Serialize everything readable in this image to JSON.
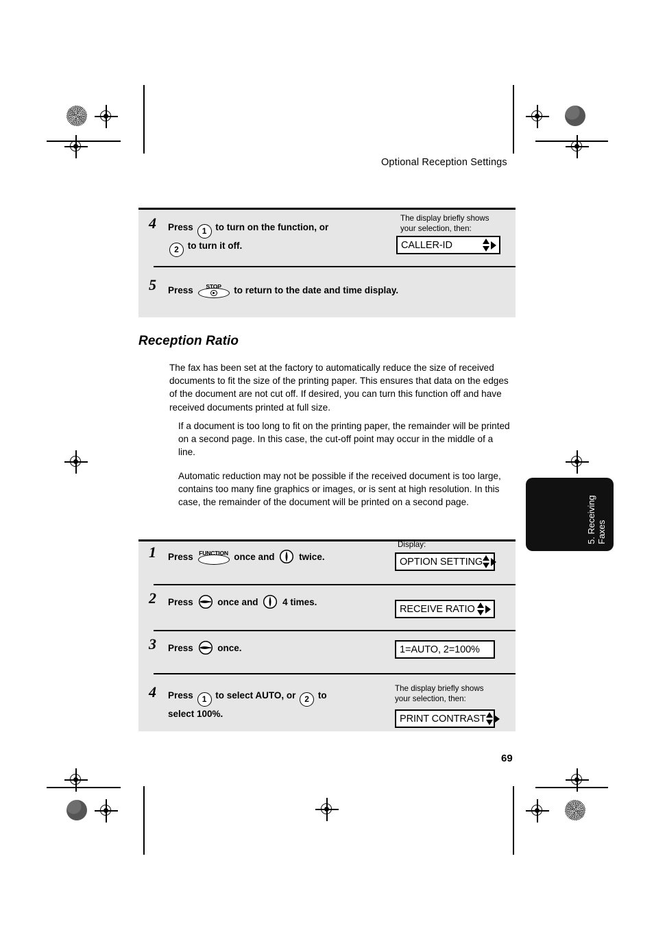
{
  "page": {
    "running_head": "Optional Reception Settings",
    "page_number": "69",
    "thumb_tab": "5. Receiving\nFaxes"
  },
  "top_panel": {
    "steps": [
      {
        "number": "4",
        "lines": [
          {
            "segments": [
              {
                "type": "text",
                "value": "Press "
              },
              {
                "type": "key-circle",
                "value": "1"
              },
              {
                "type": "text",
                "value": " to turn on the function, or"
              }
            ]
          },
          {
            "segments": [
              {
                "type": "key-circle",
                "value": "2"
              },
              {
                "type": "text",
                "value": " to turn it off."
              }
            ]
          }
        ],
        "note": "The display briefly shows\nyour selection, then:",
        "lcd": {
          "text": "CALLER-ID",
          "arrows": "up-down-right"
        }
      },
      {
        "number": "5",
        "lines": [
          {
            "segments": [
              {
                "type": "text",
                "value": "Press "
              },
              {
                "type": "key-stop",
                "value": "STOP"
              },
              {
                "type": "text",
                "value": " to return to the date and time display."
              }
            ]
          }
        ],
        "note": "",
        "lcd": null
      }
    ]
  },
  "section": {
    "heading": "Reception Ratio",
    "paragraphs": [
      "The fax has been set at the factory to automatically reduce the size of received documents to fit the size of the printing paper. This ensures that data on the edges of the document are not cut off. If desired, you can turn this function off and have received documents printed at full size.",
      "If a document is too long to fit on the printing paper, the remainder will be printed on a second page. In this case, the cut-off point may occur in the middle of a line.",
      "Automatic reduction may not be possible if the received document is too large, contains too many fine graphics or images, or is sent at high resolution. In this case, the remainder of the document will be printed on a second page."
    ]
  },
  "bottom_panel": {
    "steps": [
      {
        "number": "1",
        "lines": [
          {
            "segments": [
              {
                "type": "text",
                "value": "Press "
              },
              {
                "type": "key-function",
                "value": "FUNCTION"
              },
              {
                "type": "text",
                "value": " once and "
              },
              {
                "type": "key-down",
                "value": "down"
              },
              {
                "type": "text",
                "value": " twice."
              }
            ]
          }
        ],
        "note": "Display:",
        "lcd": {
          "text": "OPTION SETTING",
          "arrows": "up-down-right"
        }
      },
      {
        "number": "2",
        "lines": [
          {
            "segments": [
              {
                "type": "text",
                "value": "Press "
              },
              {
                "type": "key-right",
                "value": "right"
              },
              {
                "type": "text",
                "value": " once and "
              },
              {
                "type": "key-down",
                "value": "down"
              },
              {
                "type": "text",
                "value": " 4 times."
              }
            ]
          }
        ],
        "note": "",
        "lcd": {
          "text": "RECEIVE RATIO",
          "arrows": "up-down-right"
        }
      },
      {
        "number": "3",
        "lines": [
          {
            "segments": [
              {
                "type": "text",
                "value": "Press "
              },
              {
                "type": "key-right",
                "value": "right"
              },
              {
                "type": "text",
                "value": " once."
              }
            ]
          }
        ],
        "note": "",
        "lcd": {
          "text": "1=AUTO, 2=100%",
          "arrows": "none"
        }
      },
      {
        "number": "4",
        "lines": [
          {
            "segments": [
              {
                "type": "text",
                "value": "Press "
              },
              {
                "type": "key-circle",
                "value": "1"
              },
              {
                "type": "text",
                "value": " to select AUTO, or "
              },
              {
                "type": "key-circle",
                "value": "2"
              },
              {
                "type": "text",
                "value": " to"
              }
            ]
          },
          {
            "segments": [
              {
                "type": "text",
                "value": "select 100%."
              }
            ]
          }
        ],
        "note": "The display briefly shows\nyour selection, then:",
        "lcd": {
          "text": "PRINT CONTRAST",
          "arrows": "up-down-right"
        }
      }
    ]
  }
}
